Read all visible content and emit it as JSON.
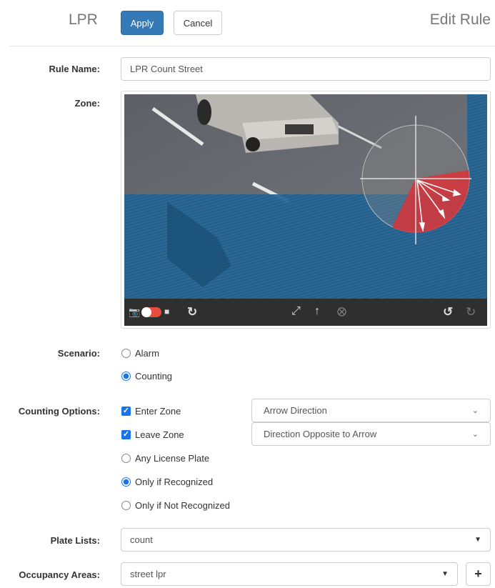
{
  "header": {
    "app_title": "LPR",
    "apply_label": "Apply",
    "cancel_label": "Cancel",
    "page_title": "Edit Rule"
  },
  "rule_name": {
    "label": "Rule Name:",
    "value": "LPR Count Street"
  },
  "zone": {
    "label": "Zone:"
  },
  "scenario": {
    "label": "Scenario:",
    "options": [
      {
        "label": "Alarm",
        "selected": false
      },
      {
        "label": "Counting",
        "selected": true
      }
    ]
  },
  "counting_options": {
    "label": "Counting Options:",
    "enter_zone": {
      "label": "Enter Zone",
      "checked": true,
      "direction": "Arrow Direction"
    },
    "leave_zone": {
      "label": "Leave Zone",
      "checked": true,
      "direction": "Direction Opposite to Arrow"
    },
    "plate_options": [
      {
        "label": "Any License Plate",
        "selected": false
      },
      {
        "label": "Only if Recognized",
        "selected": true
      },
      {
        "label": "Only if Not Recognized",
        "selected": false
      }
    ]
  },
  "plate_lists": {
    "label": "Plate Lists:",
    "value": "count"
  },
  "occupancy_areas": {
    "label": "Occupancy Areas:",
    "value": "street lpr",
    "add_label": "+"
  },
  "icons": {
    "snapshot": "camera-icon",
    "toggle": "live-toggle",
    "video": "video-camera-icon",
    "refresh": "refresh-icon",
    "expand": "expand-icon",
    "up": "arrow-up-icon",
    "clear": "clear-icon",
    "undo": "undo-icon",
    "redo": "redo-icon"
  },
  "colors": {
    "primary": "#337ab7",
    "checked": "#1a73e8",
    "zone_overlay": "#1f5f8f",
    "direction_sector": "#d8343a"
  }
}
